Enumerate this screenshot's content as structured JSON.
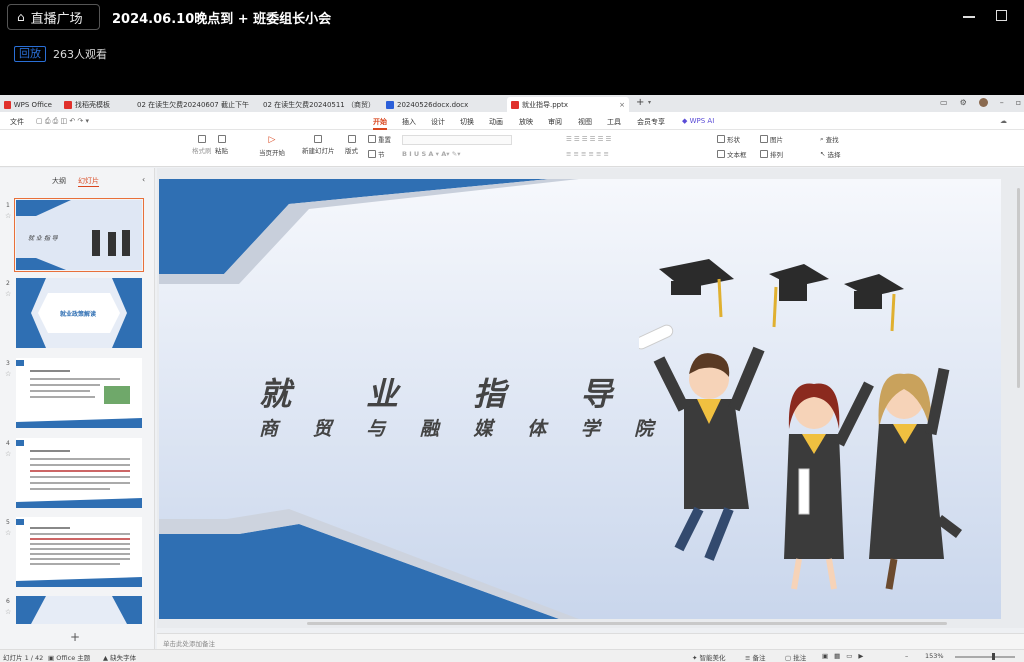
{
  "live": {
    "home_label": "直播广场",
    "title": "2024.06.10晚点到 + 班委组长小会",
    "replay_tag": "回放",
    "viewers": "263人观看"
  },
  "tabs": [
    {
      "label": "WPS Office",
      "color": "#e0302b"
    },
    {
      "label": "找稻壳模板",
      "color": "#e0302b"
    },
    {
      "label": "02 在读生欠费20240607 截止下午",
      "color": "#1c9a5a"
    },
    {
      "label": "02 在读生欠费20240511 （商贸）",
      "color": "#1c9a5a"
    },
    {
      "label": "20240526docx.docx",
      "color": "#2b5fd9"
    },
    {
      "label": "就业指导.pptx",
      "color": "#e0302b"
    }
  ],
  "menu": {
    "file": "文件",
    "items": [
      "开始",
      "插入",
      "设计",
      "切换",
      "动画",
      "放映",
      "审阅",
      "视图",
      "工具",
      "会员专享"
    ],
    "ai": "WPS AI"
  },
  "ribbon": {
    "format_painter": "格式刷",
    "paste": "粘贴",
    "from_current": "当页开始",
    "new_slide": "新建幻灯片",
    "layout": "版式",
    "reset": "重置",
    "section": "节",
    "shape": "形状",
    "picture": "图片",
    "find": "查找",
    "textbox": "文本框",
    "arrange": "排列",
    "select": "选择"
  },
  "side": {
    "outline_tab": "大纲",
    "slides_tab": "幻灯片",
    "add": "+"
  },
  "slide": {
    "title": "就 业 指 导",
    "subtitle": "商 贸 与 融 媒 体 学 院"
  },
  "thumbs": {
    "slide2_text": "就业政策解读"
  },
  "notes_placeholder": "单击此处添加备注",
  "status": {
    "slide_count": "幻灯片 1 / 42",
    "theme": "Office 主题",
    "missing_font": "缺失字体",
    "smart_beautify": "智能美化",
    "notes": "备注",
    "comments": "批注",
    "zoom": "153%"
  },
  "colors": {
    "accent": "#d9461e",
    "slide_blue": "#2f6fb3"
  }
}
